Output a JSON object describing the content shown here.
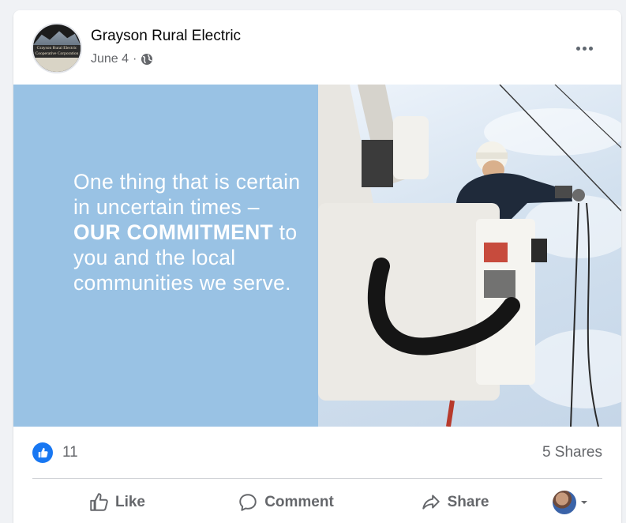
{
  "post": {
    "page_name": "Grayson Rural Electric",
    "avatar_text": "Grayson Rural Electric Cooperative Corporation",
    "date": "June 4",
    "separator": "·",
    "audience_icon": "globe-icon",
    "more_icon": "more-horizontal-icon"
  },
  "image": {
    "quote_part1": "One thing that is certain in uncertain times – ",
    "quote_bold1": "OUR",
    "quote_bold2": "COMMITMENT",
    "quote_part2": " to you and the local communities we serve.",
    "panel_color": "#99c2e4"
  },
  "engagement": {
    "reaction_icon": "like-reaction-icon",
    "reaction_count": "11",
    "shares": "5 Shares"
  },
  "actions": {
    "like_label": "Like",
    "comment_label": "Comment",
    "share_label": "Share"
  },
  "colors": {
    "accent": "#1877f2",
    "muted_text": "#65676b"
  }
}
